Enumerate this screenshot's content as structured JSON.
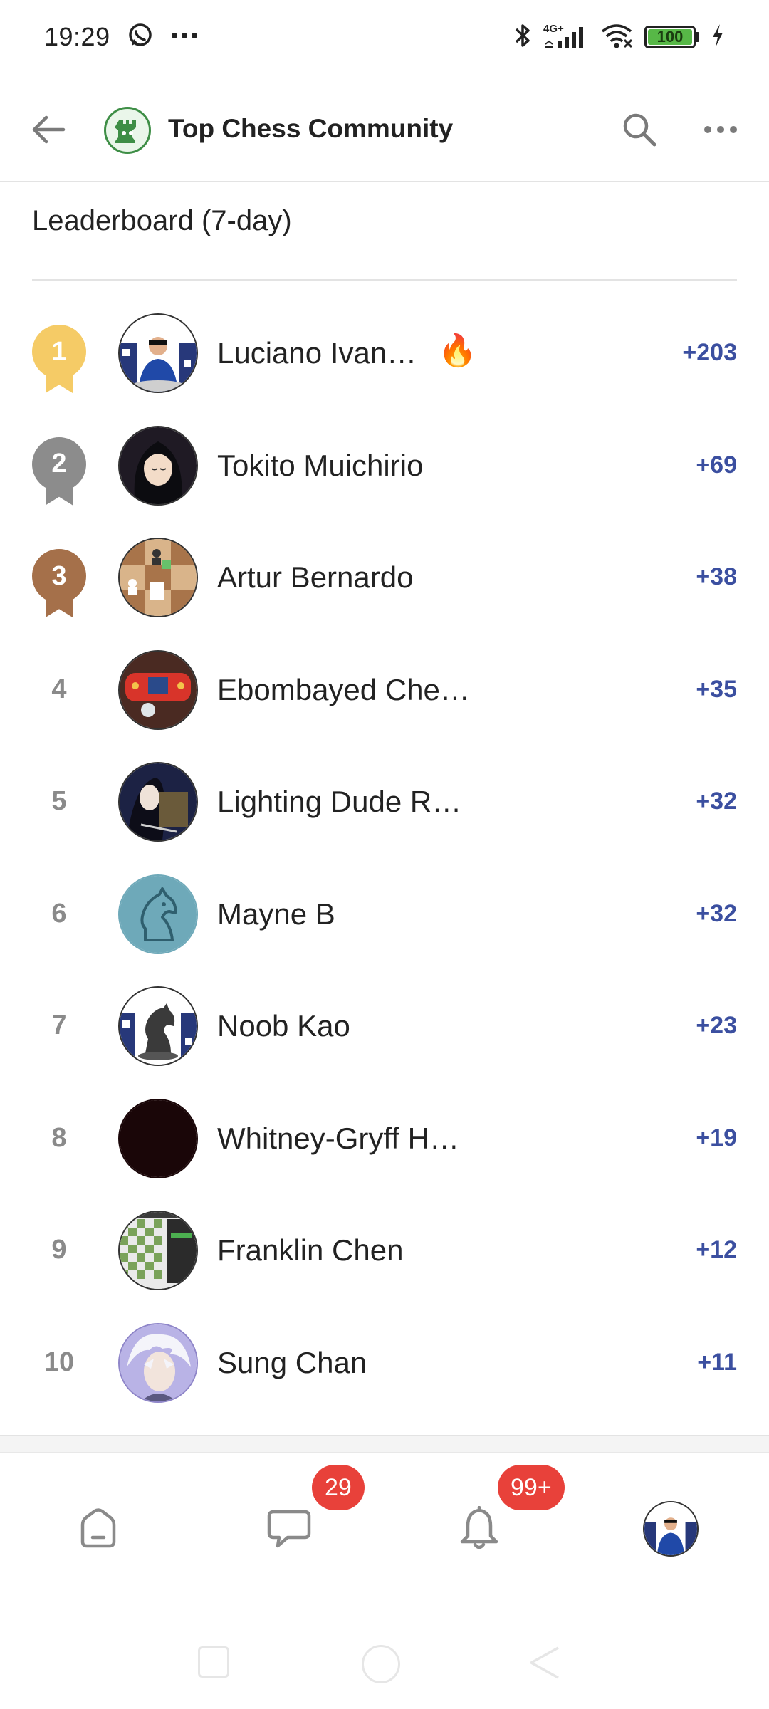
{
  "status_bar": {
    "time": "19:29",
    "network": "4G+",
    "battery": "100"
  },
  "header": {
    "title": "Top Chess Community"
  },
  "section": {
    "title": "Leaderboard (7-day)"
  },
  "leaderboard": [
    {
      "rank": "1",
      "name": "Luciano Ivan…",
      "score": "+203",
      "badge": "🔥"
    },
    {
      "rank": "2",
      "name": "Tokito Muichirio",
      "score": "+69"
    },
    {
      "rank": "3",
      "name": "Artur Bernardo",
      "score": "+38"
    },
    {
      "rank": "4",
      "name": "Ebombayed Che…",
      "score": "+35"
    },
    {
      "rank": "5",
      "name": "Lighting Dude R…",
      "score": "+32"
    },
    {
      "rank": "6",
      "name": "Mayne B",
      "score": "+32"
    },
    {
      "rank": "7",
      "name": "Noob Kao",
      "score": "+23"
    },
    {
      "rank": "8",
      "name": "Whitney-Gryff H…",
      "score": "+19"
    },
    {
      "rank": "9",
      "name": "Franklin Chen",
      "score": "+12"
    },
    {
      "rank": "10",
      "name": "Sung Chan",
      "score": "+11"
    }
  ],
  "bottom_nav": {
    "chats_badge": "29",
    "notifications_badge": "99+"
  },
  "colors": {
    "score": "#3b4fa0",
    "gold": "#f5cb66",
    "silver": "#8c8c8c",
    "bronze": "#a5704a",
    "badge_red": "#e8413a"
  }
}
